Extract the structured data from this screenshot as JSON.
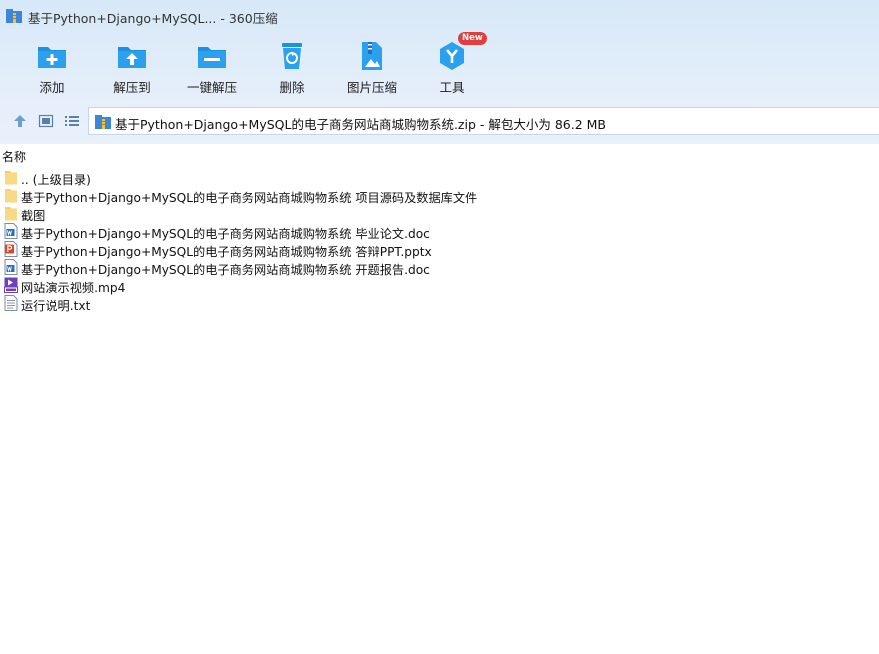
{
  "window": {
    "title": "基于Python+Django+MySQL... - 360压缩",
    "app_icon": "archive-icon"
  },
  "toolbar": {
    "items": [
      {
        "label": "添加",
        "icon": "add-folder-icon",
        "color": "#1e90e0"
      },
      {
        "label": "解压到",
        "icon": "extract-to-icon",
        "color": "#1e90e0"
      },
      {
        "label": "一键解压",
        "icon": "one-click-extract-icon",
        "color": "#1e90e0"
      },
      {
        "label": "删除",
        "icon": "delete-trash-icon",
        "color": "#1e90e0"
      },
      {
        "label": "图片压缩",
        "icon": "image-compress-icon",
        "color": "#1e90e0"
      },
      {
        "label": "工具",
        "icon": "tools-icon",
        "color": "#1e90e0",
        "badge": "New"
      }
    ]
  },
  "nav": {
    "up_icon": "arrow-up-icon",
    "view_thumb_icon": "thumbnail-view-icon",
    "view_list_icon": "list-view-icon"
  },
  "address": {
    "text": "基于Python+Django+MySQL的电子商务网站商城购物系统.zip - 解包大小为 86.2 MB",
    "icon": "zip-archive-icon"
  },
  "list": {
    "column_name": "名称",
    "rows": [
      {
        "name": ".. (上级目录)",
        "type": "folder"
      },
      {
        "name": "基于Python+Django+MySQL的电子商务网站商城购物系统 项目源码及数据库文件",
        "type": "folder"
      },
      {
        "name": "截图",
        "type": "folder"
      },
      {
        "name": "基于Python+Django+MySQL的电子商务网站商城购物系统 毕业论文.doc",
        "type": "doc"
      },
      {
        "name": "基于Python+Django+MySQL的电子商务网站商城购物系统 答辩PPT.pptx",
        "type": "ppt"
      },
      {
        "name": "基于Python+Django+MySQL的电子商务网站商城购物系统 开题报告.doc",
        "type": "doc"
      },
      {
        "name": "网站演示视频.mp4",
        "type": "video"
      },
      {
        "name": "运行说明.txt",
        "type": "txt"
      }
    ]
  },
  "colors": {
    "header_bg": "#dfeaf8",
    "icon_blue": "#1e90e0",
    "badge_red": "#e23d3d",
    "folder_yellow": "#f5cf6b"
  }
}
